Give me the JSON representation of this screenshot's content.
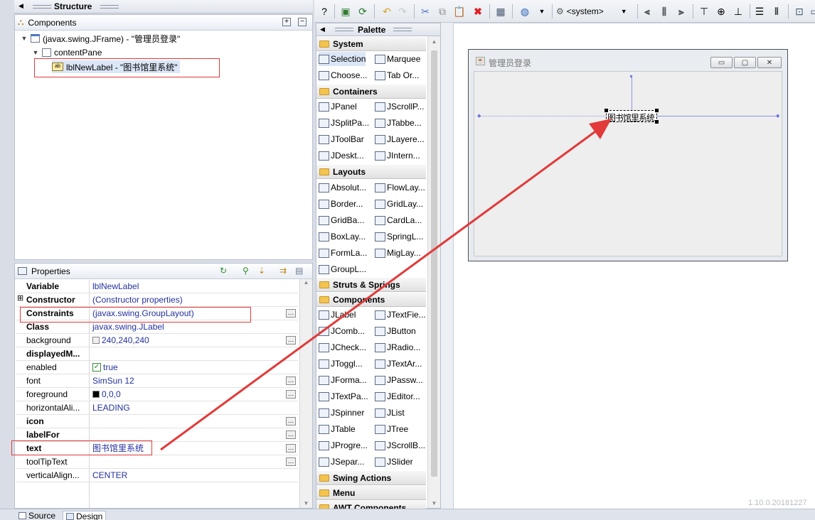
{
  "structure": {
    "header": "Structure",
    "components_title": "Components",
    "tree": [
      {
        "label": "(javax.swing.JFrame) - \"管理员登录\"",
        "level": 0,
        "expanded": true
      },
      {
        "label": "contentPane",
        "level": 1,
        "expanded": true
      },
      {
        "label": "lblNewLabel - \"图书馆里系统\"",
        "level": 2,
        "selected": true
      }
    ]
  },
  "properties": {
    "title": "Properties",
    "rows": [
      {
        "name": "Variable",
        "value": "lblNewLabel",
        "bold": true,
        "ellipsis": false
      },
      {
        "name": "Constructor",
        "value": "(Constructor properties)",
        "bold": true,
        "ellipsis": false,
        "expandable": true
      },
      {
        "name": "Constraints",
        "value": "(javax.swing.GroupLayout)",
        "bold": true,
        "ellipsis": true
      },
      {
        "name": "Class",
        "value": "javax.swing.JLabel",
        "bold": true,
        "ellipsis": false
      },
      {
        "name": "background",
        "value": "240,240,240",
        "bold": false,
        "ellipsis": true,
        "swatch": "#f0f0f0"
      },
      {
        "name": "displayedM...",
        "value": "",
        "bold": true,
        "ellipsis": false
      },
      {
        "name": "enabled",
        "value": "true",
        "bold": false,
        "ellipsis": false,
        "checkbox": true
      },
      {
        "name": "font",
        "value": "SimSun 12",
        "bold": false,
        "ellipsis": true
      },
      {
        "name": "foreground",
        "value": "0,0,0",
        "bold": false,
        "ellipsis": true,
        "swatch": "#000000"
      },
      {
        "name": "horizontalAli...",
        "value": "LEADING",
        "bold": false,
        "ellipsis": false
      },
      {
        "name": "icon",
        "value": "",
        "bold": true,
        "ellipsis": true
      },
      {
        "name": "labelFor",
        "value": "",
        "bold": true,
        "ellipsis": true
      },
      {
        "name": "text",
        "value": "图书馆里系统",
        "bold": true,
        "ellipsis": true
      },
      {
        "name": "toolTipText",
        "value": "",
        "bold": false,
        "ellipsis": true
      },
      {
        "name": "verticalAlign...",
        "value": "CENTER",
        "bold": false,
        "ellipsis": false
      }
    ]
  },
  "toolbar": {
    "look_and_feel": "<system>"
  },
  "palette": {
    "header": "Palette",
    "categories": {
      "system": "System",
      "containers": "Containers",
      "layouts": "Layouts",
      "struts": "Struts & Springs",
      "components": "Components",
      "swing_actions": "Swing Actions",
      "menu": "Menu",
      "awt": "AWT Components"
    },
    "system_items": [
      "Selection",
      "Marquee",
      "Choose...",
      "Tab Or..."
    ],
    "container_items": [
      "JPanel",
      "JScrollP...",
      "JSplitPa...",
      "JTabbe...",
      "JToolBar",
      "JLayere...",
      "JDeskt...",
      "JIntern..."
    ],
    "layout_items": [
      "Absolut...",
      "FlowLay...",
      "Border...",
      "GridLay...",
      "GridBa...",
      "CardLa...",
      "BoxLay...",
      "SpringL...",
      "FormLa...",
      "MigLay...",
      "GroupL..."
    ],
    "component_items": [
      "JLabel",
      "JTextFie...",
      "JComb...",
      "JButton",
      "JCheck...",
      "JRadio...",
      "JToggl...",
      "JTextAr...",
      "JForma...",
      "JPassw...",
      "JTextPa...",
      "JEditor...",
      "JSpinner",
      "JList",
      "JTable",
      "JTree",
      "JProgre...",
      "JScrollB...",
      "JSepar...",
      "JSlider"
    ]
  },
  "design": {
    "frame_title": "管理员登录",
    "label_text": "图书馆里系统",
    "version": "1.10.0.20181227"
  },
  "bottom_tabs": [
    "Source",
    "Design"
  ],
  "colors": {
    "annotation": "#e23a3a",
    "value_text": "#23319c"
  }
}
